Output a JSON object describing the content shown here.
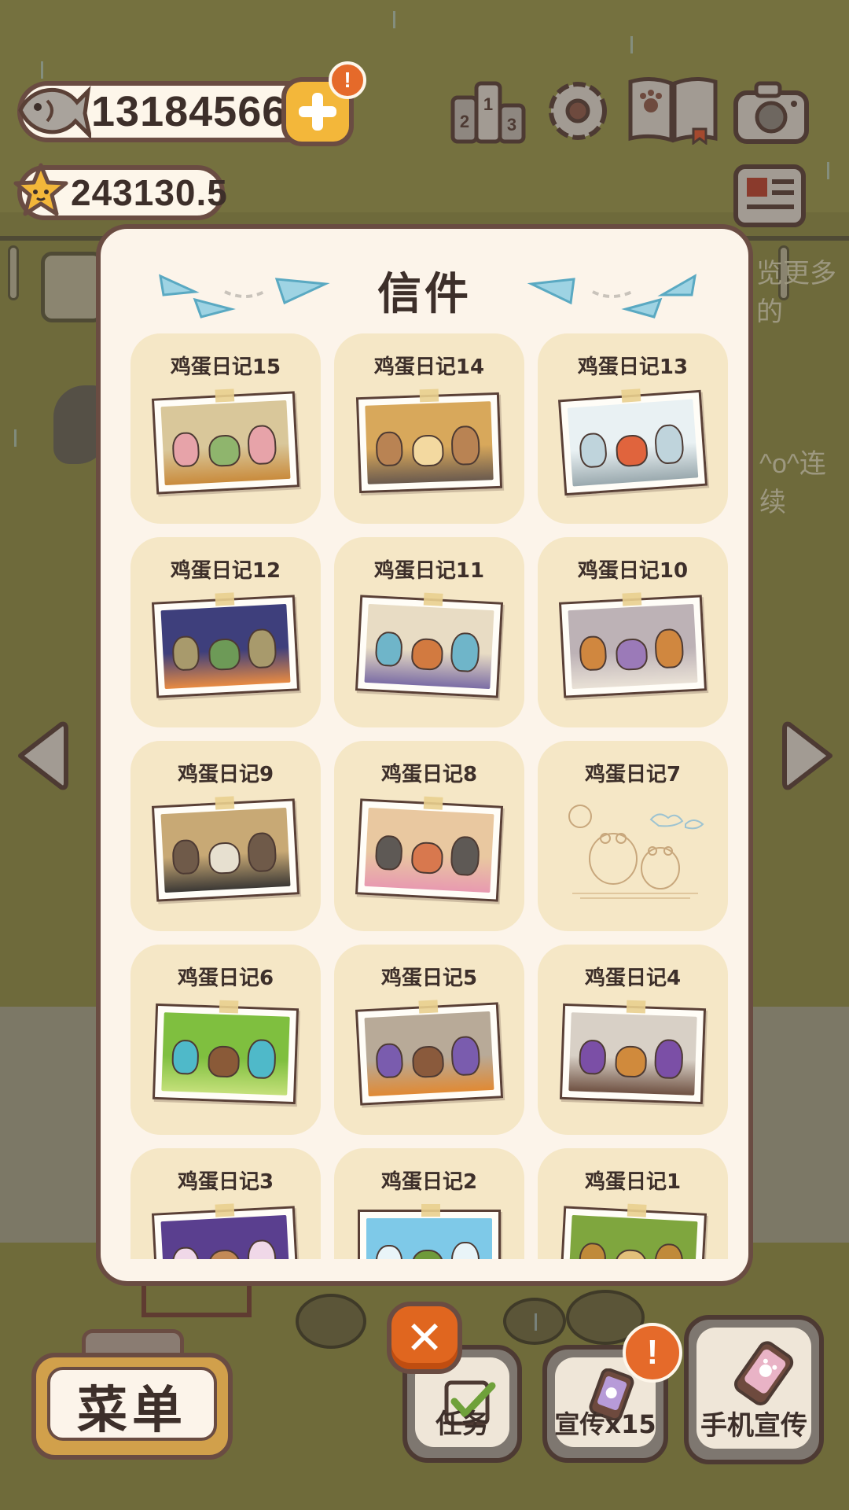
{
  "currency": {
    "fish_value": "13184566",
    "star_value": "243130.5",
    "plus_badge": "!"
  },
  "background": {
    "partial_text_1": "览更多的",
    "partial_text_2": "^o^连续"
  },
  "letters_panel": {
    "title": "信件",
    "cards": [
      {
        "title": "鸡蛋日记15",
        "palette": [
          "#d9c79a",
          "#e7a3a9",
          "#8fb56d",
          "#c98b3c"
        ]
      },
      {
        "title": "鸡蛋日记14",
        "palette": [
          "#d8a85b",
          "#b98353",
          "#f3d9a0",
          "#6a5a4e"
        ]
      },
      {
        "title": "鸡蛋日记13",
        "palette": [
          "#e9f1f3",
          "#bfd4dc",
          "#e0643d",
          "#9aa9ae"
        ]
      },
      {
        "title": "鸡蛋日记12",
        "palette": [
          "#3e3f7c",
          "#a89a6c",
          "#6d9a57",
          "#e88b42"
        ]
      },
      {
        "title": "鸡蛋日记11",
        "palette": [
          "#e8dcc4",
          "#6fb5c9",
          "#d27a40",
          "#7b6da5"
        ]
      },
      {
        "title": "鸡蛋日记10",
        "palette": [
          "#bdb2b6",
          "#d0873f",
          "#9b7ab8",
          "#e9e1d6"
        ]
      },
      {
        "title": "鸡蛋日记9",
        "palette": [
          "#c8a975",
          "#6f5a49",
          "#e7e0d0",
          "#3b3835"
        ]
      },
      {
        "title": "鸡蛋日记8",
        "palette": [
          "#e9c8a0",
          "#5e5955",
          "#d8784e",
          "#e89ab0"
        ]
      },
      {
        "title": "鸡蛋日记7",
        "palette": [
          "#f5e7c6",
          "#c8a77c",
          "#9dc3d1",
          "#e0c79e"
        ]
      },
      {
        "title": "鸡蛋日记6",
        "palette": [
          "#7fbf3f",
          "#4fb9c9",
          "#8a5a38",
          "#c4e07a"
        ]
      },
      {
        "title": "鸡蛋日记5",
        "palette": [
          "#b8aa98",
          "#7a5cae",
          "#8a5a3c",
          "#e08a34"
        ]
      },
      {
        "title": "鸡蛋日记4",
        "palette": [
          "#d8d0c6",
          "#7b4fa6",
          "#d08a3c",
          "#6f5142"
        ]
      },
      {
        "title": "鸡蛋日记3",
        "palette": [
          "#5a3f8f",
          "#f0d8e8",
          "#c38a56",
          "#3e2f5e"
        ]
      },
      {
        "title": "鸡蛋日记2",
        "palette": [
          "#7ec9e8",
          "#e9f4f8",
          "#6f9a3a",
          "#c9a95c"
        ]
      },
      {
        "title": "鸡蛋日记1",
        "palette": [
          "#7fa63e",
          "#c08a3a",
          "#e2c07a",
          "#5c7a2e"
        ]
      }
    ]
  },
  "bottom_bar": {
    "menu_label": "菜单",
    "close_label": "✕",
    "task_label": "任务",
    "promo_label": "宣传x15",
    "promo_badge": "!",
    "phone_promo_label": "手机宣传"
  },
  "colors": {
    "panel_bg": "#fcf4ea",
    "card_bg": "#f5e7c6",
    "outline": "#6a4c42",
    "accent_orange": "#e0661f",
    "accent_yellow": "#f3b73a"
  }
}
